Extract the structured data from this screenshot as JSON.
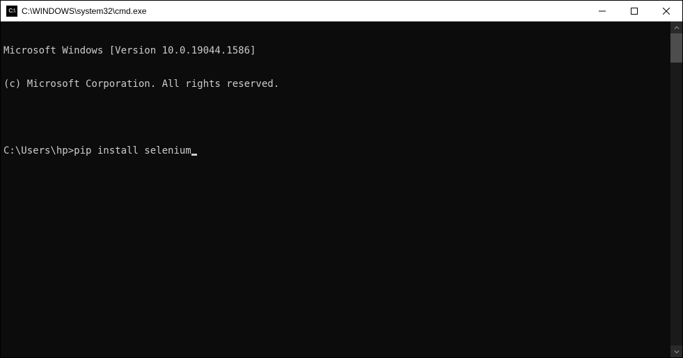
{
  "window": {
    "icon_label": "C:\\",
    "title": "C:\\WINDOWS\\system32\\cmd.exe"
  },
  "terminal": {
    "line1": "Microsoft Windows [Version 10.0.19044.1586]",
    "line2": "(c) Microsoft Corporation. All rights reserved.",
    "blank": "",
    "prompt": "C:\\Users\\hp>",
    "command": "pip install selenium"
  }
}
